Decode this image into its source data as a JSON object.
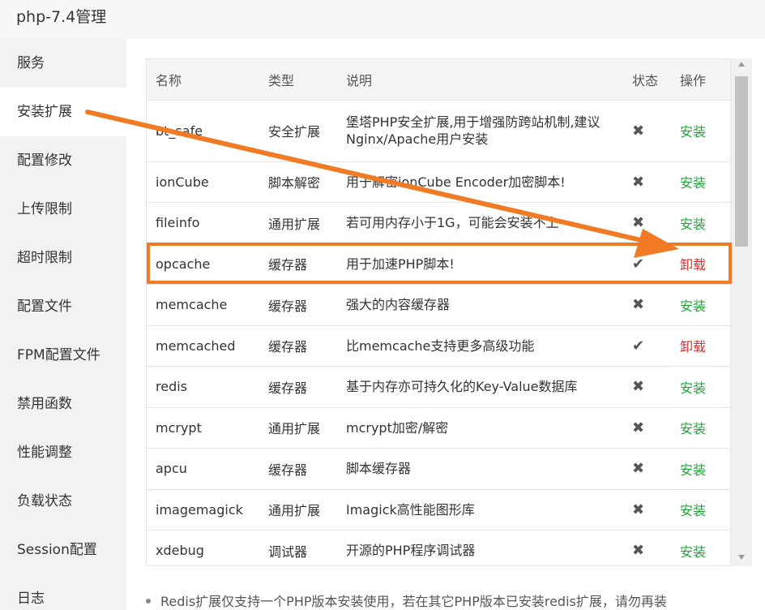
{
  "window": {
    "title": "php-7.4管理"
  },
  "sidebar": {
    "items": [
      {
        "label": "服务"
      },
      {
        "label": "安装扩展"
      },
      {
        "label": "配置修改"
      },
      {
        "label": "上传限制"
      },
      {
        "label": "超时限制"
      },
      {
        "label": "配置文件"
      },
      {
        "label": "FPM配置文件"
      },
      {
        "label": "禁用函数"
      },
      {
        "label": "性能调整"
      },
      {
        "label": "负载状态"
      },
      {
        "label": "Session配置"
      },
      {
        "label": "日志"
      }
    ],
    "active_index": 1
  },
  "table": {
    "headers": {
      "name": "名称",
      "type": "类型",
      "desc": "说明",
      "status": "状态",
      "action": "操作"
    },
    "rows": [
      {
        "name": "bt_safe",
        "type": "安全扩展",
        "desc": "堡塔PHP安全扩展,用于增强防跨站机制,建议Nginx/Apache用户安装",
        "status": "✖",
        "action": "安装"
      },
      {
        "name": "ionCube",
        "type": "脚本解密",
        "desc": "用于解密ionCube Encoder加密脚本!",
        "status": "✖",
        "action": "安装"
      },
      {
        "name": "fileinfo",
        "type": "通用扩展",
        "desc": "若可用内存小于1G，可能会安装不上",
        "status": "✖",
        "action": "安装"
      },
      {
        "name": "opcache",
        "type": "缓存器",
        "desc": "用于加速PHP脚本!",
        "status": "✔",
        "action": "卸载"
      },
      {
        "name": "memcache",
        "type": "缓存器",
        "desc": "强大的内容缓存器",
        "status": "✖",
        "action": "安装"
      },
      {
        "name": "memcached",
        "type": "缓存器",
        "desc": "比memcache支持更多高级功能",
        "status": "✔",
        "action": "卸载"
      },
      {
        "name": "redis",
        "type": "缓存器",
        "desc": "基于内存亦可持久化的Key-Value数据库",
        "status": "✖",
        "action": "安装"
      },
      {
        "name": "mcrypt",
        "type": "通用扩展",
        "desc": "mcrypt加密/解密",
        "status": "✖",
        "action": "安装"
      },
      {
        "name": "apcu",
        "type": "缓存器",
        "desc": "脚本缓存器",
        "status": "✖",
        "action": "安装"
      },
      {
        "name": "imagemagick",
        "type": "通用扩展",
        "desc": "Imagick高性能图形库",
        "status": "✖",
        "action": "安装"
      },
      {
        "name": "xdebug",
        "type": "调试器",
        "desc": "开源的PHP程序调试器",
        "status": "✖",
        "action": "安装"
      }
    ]
  },
  "note": {
    "text": "Redis扩展仅支持一个PHP版本安装使用，若在其它PHP版本已安装redis扩展，请勿再装"
  },
  "colors": {
    "install": "#20a53a",
    "uninstall": "#d62e2e",
    "annotation": "#f07b24"
  },
  "icons": {
    "not_installed": "x-icon",
    "installed": "check-icon"
  }
}
